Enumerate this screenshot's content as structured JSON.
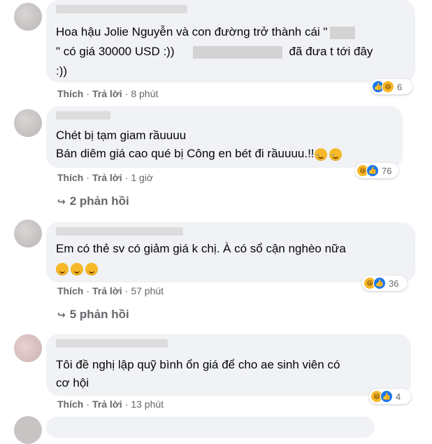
{
  "comments": [
    {
      "lines": [
        "Hoa hậu Jolie Nguyễn và con đường trở thành cái \"",
        "\" có giá 30000 USD :))",
        "đã đưa t tới đây",
        ":))"
      ],
      "actions": {
        "like": "Thích",
        "reply": "Trả lời",
        "time": "8 phút"
      },
      "reactions": {
        "icons": [
          "like-icon",
          "haha-icon"
        ],
        "count": "6"
      }
    },
    {
      "lines": [
        "Chét bị tạm giam rầuuuu",
        "Bán diêm giá cao qué bị Công en bét đi rầuuuu.!!"
      ],
      "actions": {
        "like": "Thích",
        "reply": "Trả lời",
        "time": "1 giờ"
      },
      "reactions": {
        "icons": [
          "haha-icon",
          "like-icon"
        ],
        "count": "76"
      },
      "replies": "2 phản hồi"
    },
    {
      "lines": [
        "Em có thẻ sv có giảm giá k chị. À có sổ cận nghèo nữa"
      ],
      "actions": {
        "like": "Thích",
        "reply": "Trả lời",
        "time": "57 phút"
      },
      "reactions": {
        "icons": [
          "haha-icon",
          "like-icon"
        ],
        "count": "36"
      },
      "replies": "5 phản hồi"
    },
    {
      "lines": [
        "Tôi đề nghị lập quỹ bình ổn giá để cho ae sinh viên có",
        "cơ hội"
      ],
      "actions": {
        "like": "Thích",
        "reply": "Trả lời",
        "time": "13 phút"
      },
      "reactions": {
        "icons": [
          "haha-icon",
          "like-icon"
        ],
        "count": "4"
      }
    }
  ],
  "colors": {
    "bubble": "#f0f2f5",
    "meta": "#65676b",
    "text": "#050505",
    "like": "#1877f2",
    "haha": "#f7b928"
  }
}
